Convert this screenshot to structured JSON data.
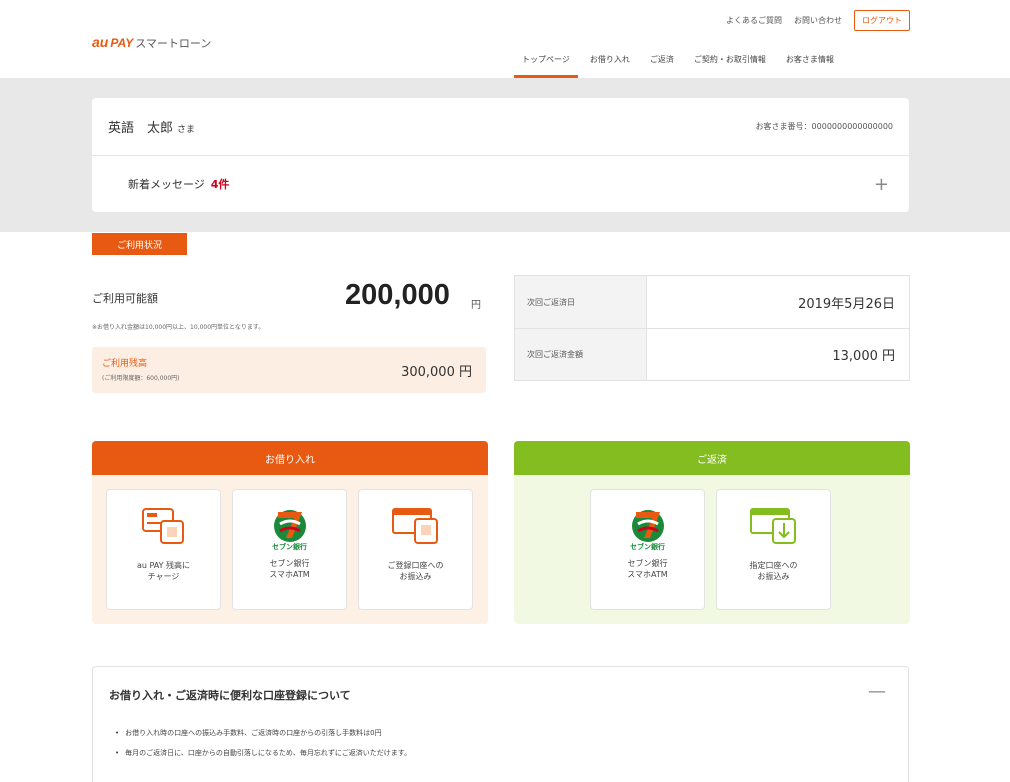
{
  "header": {
    "logo_au": "au",
    "logo_pay": "PAY",
    "logo_name": "スマートローン",
    "util_links": [
      "よくあるご質問",
      "お問い合わせ"
    ],
    "logout_label": "ログアウト",
    "nav": [
      "トップページ",
      "お借り入れ",
      "ご返済",
      "ご契約・お取引情報",
      "お客さま情報"
    ],
    "active_nav": 0
  },
  "user": {
    "name": "英語　太郎",
    "honorific": "さま",
    "customer_id": "お客さま番号：0000000000000000",
    "message_label": "新着メッセージ",
    "message_count": "4件"
  },
  "status_tag": "ご利用状況",
  "available": {
    "label": "ご利用可能額",
    "value": "200,000",
    "unit": "円",
    "note": "※お借り入れ金額は10,000円以上、10,000円単位となります。"
  },
  "balance": {
    "label": "ご利用残高",
    "sub": "(ご利用限度額：600,000円)",
    "value": "300,000 円"
  },
  "repayment": {
    "rows": [
      {
        "label": "次回ご返済日",
        "value": "2019年5月26日"
      },
      {
        "label": "次回ご返済金額",
        "value": "13,000 円"
      }
    ]
  },
  "borrow_panel": {
    "title": "お借り入れ",
    "tiles": [
      {
        "label": "au PAY 残高に\nチャージ",
        "icon": "au-card-icon"
      },
      {
        "label": "セブン銀行\nスマホATM",
        "brand": "セブン銀行",
        "icon": "seven-bank-icon"
      },
      {
        "label": "ご登録口座への\nお振込み",
        "icon": "bank-transfer-icon"
      }
    ]
  },
  "repay_panel": {
    "title": "ご返済",
    "tiles": [
      {
        "label": "セブン銀行\nスマホATM",
        "brand": "セブン銀行",
        "icon": "seven-bank-icon"
      },
      {
        "label": "指定口座への\nお振込み",
        "icon": "bank-deposit-icon"
      }
    ]
  },
  "info": {
    "title": "お借り入れ・ご返済時に便利な口座登録について",
    "bullets": [
      "お借り入れ時の口座への振込み手数料、ご返済時の口座からの引落し手数料は0円",
      "毎月のご返済日に、口座からの自動引落しになるため、毎月忘れずにご返済いただけます。"
    ]
  },
  "colors": {
    "accent": "#e85a11",
    "green": "#84bd1f",
    "alert": "#d0021b"
  }
}
